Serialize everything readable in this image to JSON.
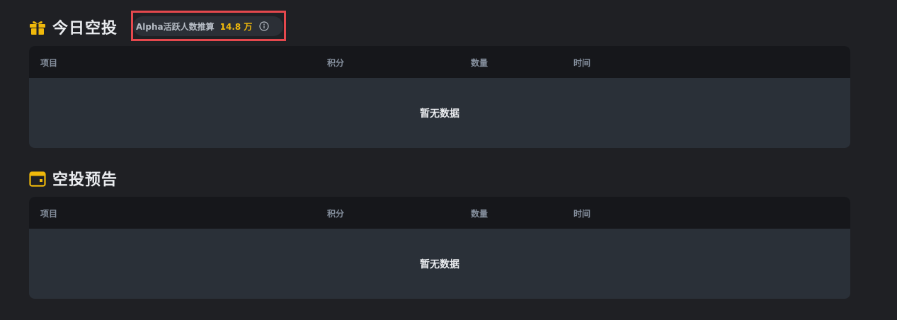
{
  "today_airdrop": {
    "title": "今日空投",
    "alpha_badge": {
      "label": "Alpha活跃人数推算",
      "value": "14.8 万"
    },
    "columns": [
      "项目",
      "积分",
      "数量",
      "时间"
    ],
    "empty_text": "暂无数据"
  },
  "airdrop_preview": {
    "title": "空投预告",
    "columns": [
      "项目",
      "积分",
      "数量",
      "时间"
    ],
    "empty_text": "暂无数据"
  },
  "icons": {
    "today_airdrop": "gift-icon",
    "airdrop_preview": "calendar-icon",
    "info": "info-icon"
  },
  "colors": {
    "accent": "#f0b90b",
    "highlight_border": "#e5484d",
    "background": "#1f2024",
    "table_header": "#16171b",
    "table_body": "#2a3038"
  }
}
